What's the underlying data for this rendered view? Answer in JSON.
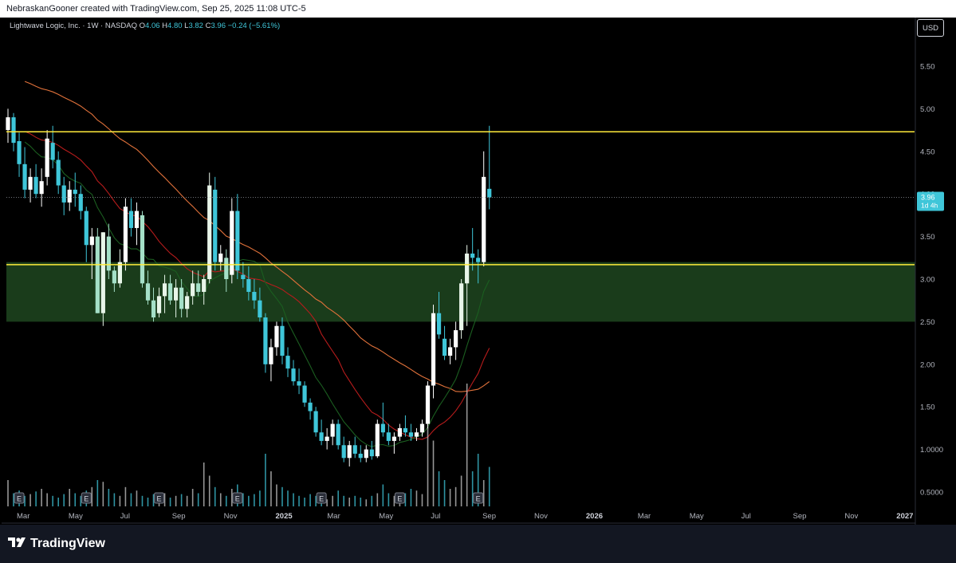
{
  "header": {
    "text": "NebraskanGooner created with TradingView.com, Sep 25, 2025 11:08 UTC-5"
  },
  "legend": {
    "symbol": "Lightwave Logic, Inc. · 1W · NASDAQ",
    "o_label": "O",
    "o": "4.06",
    "h_label": "H",
    "h": "4.80",
    "l_label": "L",
    "l": "3.82",
    "c_label": "C",
    "c": "3.96",
    "change": "−0.24 (−5.61%)"
  },
  "currency_button": "USD",
  "price_tag": {
    "price": "3.96",
    "countdown": "1d 4h"
  },
  "branding": {
    "logo_text": "TradingView"
  },
  "colors": {
    "up": "#ffffff",
    "down": "#3fc6d9",
    "ma_long": "#e0713a",
    "ma_mid": "#b71c1c",
    "ma_short": "#1b5e20",
    "resistance": "#ffeb3b",
    "zone_fill": "#1e4620",
    "axis_text": "#b2b5be",
    "bg": "#000000"
  },
  "chart_data": {
    "type": "candlestick",
    "timeframe": "1W",
    "y_ticks": [
      "5.50",
      "5.00",
      "4.50",
      "4.00",
      "3.50",
      "3.00",
      "2.50",
      "2.00",
      "1.50",
      "1.0000",
      "0.5000"
    ],
    "x_ticks": [
      "Mar",
      "May",
      "Jul",
      "Sep",
      "Nov",
      "2025",
      "Mar",
      "May",
      "Jul",
      "Sep",
      "Nov",
      "2026",
      "Mar",
      "May",
      "Jul",
      "Sep",
      "Nov",
      "2027"
    ],
    "bold_x_ticks": [
      "2025",
      "2026",
      "2027"
    ],
    "ylim": [
      0.35,
      5.8
    ],
    "last_close": 3.96,
    "levels": {
      "resistance": 4.73,
      "support": 3.17,
      "zone": [
        2.5,
        3.2
      ]
    },
    "candles": [
      [
        4.75,
        5.0,
        4.6,
        4.9
      ],
      [
        4.9,
        4.95,
        4.5,
        4.6
      ],
      [
        4.62,
        4.72,
        4.2,
        4.35
      ],
      [
        4.35,
        4.55,
        3.95,
        4.05
      ],
      [
        4.05,
        4.3,
        3.9,
        4.2
      ],
      [
        4.2,
        4.35,
        3.95,
        4.0
      ],
      [
        4.0,
        4.3,
        3.85,
        4.15
      ],
      [
        4.2,
        4.75,
        4.1,
        4.65
      ],
      [
        4.6,
        4.8,
        4.3,
        4.4
      ],
      [
        4.4,
        4.5,
        4.0,
        4.1
      ],
      [
        4.1,
        4.2,
        3.75,
        3.9
      ],
      [
        3.9,
        4.15,
        3.8,
        4.05
      ],
      [
        4.05,
        4.25,
        3.85,
        4.0
      ],
      [
        4.0,
        4.1,
        3.7,
        3.8
      ],
      [
        3.8,
        3.85,
        3.2,
        3.4
      ],
      [
        3.4,
        3.6,
        3.0,
        3.5
      ],
      [
        3.5,
        3.6,
        2.6,
        2.6
      ],
      [
        2.6,
        3.55,
        2.45,
        3.55
      ],
      [
        3.5,
        3.65,
        3.0,
        3.1
      ],
      [
        3.1,
        3.15,
        2.85,
        2.95
      ],
      [
        2.95,
        3.35,
        2.9,
        3.2
      ],
      [
        3.2,
        3.95,
        3.1,
        3.85
      ],
      [
        3.8,
        3.95,
        3.5,
        3.6
      ],
      [
        3.6,
        3.9,
        3.4,
        3.8
      ],
      [
        3.75,
        3.8,
        2.9,
        2.95
      ],
      [
        2.95,
        3.1,
        2.7,
        2.75
      ],
      [
        2.75,
        2.9,
        2.5,
        2.55
      ],
      [
        2.6,
        2.9,
        2.55,
        2.8
      ],
      [
        2.8,
        3.05,
        2.6,
        2.95
      ],
      [
        2.95,
        3.05,
        2.7,
        2.75
      ],
      [
        2.75,
        3.0,
        2.55,
        2.9
      ],
      [
        2.9,
        3.0,
        2.55,
        2.65
      ],
      [
        2.65,
        2.85,
        2.55,
        2.8
      ],
      [
        2.8,
        3.1,
        2.7,
        2.95
      ],
      [
        2.95,
        3.1,
        2.8,
        2.85
      ],
      [
        2.85,
        3.05,
        2.7,
        3.0
      ],
      [
        3.0,
        4.25,
        2.95,
        4.1
      ],
      [
        4.05,
        4.2,
        3.1,
        3.2
      ],
      [
        3.2,
        3.4,
        3.1,
        3.3
      ],
      [
        3.25,
        3.35,
        2.85,
        3.0
      ],
      [
        3.05,
        3.95,
        2.95,
        3.8
      ],
      [
        3.8,
        4.0,
        3.0,
        3.1
      ],
      [
        3.05,
        3.2,
        2.9,
        3.0
      ],
      [
        3.0,
        3.15,
        2.75,
        2.85
      ],
      [
        2.85,
        3.0,
        2.65,
        2.75
      ],
      [
        2.75,
        2.9,
        2.5,
        2.55
      ],
      [
        2.55,
        2.6,
        1.9,
        2.0
      ],
      [
        2.0,
        2.3,
        1.8,
        2.2
      ],
      [
        2.2,
        2.5,
        2.1,
        2.45
      ],
      [
        2.45,
        2.55,
        2.0,
        2.1
      ],
      [
        2.1,
        2.2,
        1.85,
        1.95
      ],
      [
        1.95,
        2.05,
        1.75,
        1.8
      ],
      [
        1.8,
        1.95,
        1.65,
        1.75
      ],
      [
        1.75,
        1.8,
        1.5,
        1.55
      ],
      [
        1.55,
        1.6,
        1.35,
        1.45
      ],
      [
        1.45,
        1.5,
        1.15,
        1.2
      ],
      [
        1.2,
        1.35,
        1.05,
        1.1
      ],
      [
        1.1,
        1.25,
        1.0,
        1.15
      ],
      [
        1.15,
        1.35,
        1.05,
        1.3
      ],
      [
        1.3,
        1.35,
        1.0,
        1.05
      ],
      [
        1.05,
        1.15,
        0.85,
        0.9
      ],
      [
        0.9,
        1.1,
        0.8,
        1.05
      ],
      [
        1.05,
        1.15,
        0.9,
        0.95
      ],
      [
        0.95,
        1.05,
        0.85,
        0.9
      ],
      [
        0.9,
        1.05,
        0.85,
        1.0
      ],
      [
        1.0,
        1.1,
        0.88,
        0.92
      ],
      [
        0.92,
        1.35,
        0.9,
        1.3
      ],
      [
        1.3,
        1.55,
        1.15,
        1.2
      ],
      [
        1.2,
        1.3,
        1.05,
        1.1
      ],
      [
        1.1,
        1.2,
        0.95,
        1.15
      ],
      [
        1.15,
        1.3,
        1.1,
        1.25
      ],
      [
        1.25,
        1.4,
        1.15,
        1.2
      ],
      [
        1.2,
        1.3,
        1.1,
        1.15
      ],
      [
        1.15,
        1.25,
        1.1,
        1.2
      ],
      [
        1.2,
        1.35,
        1.15,
        1.3
      ],
      [
        1.3,
        1.8,
        1.25,
        1.75
      ],
      [
        1.75,
        2.7,
        1.6,
        2.6
      ],
      [
        2.6,
        2.85,
        2.3,
        2.35
      ],
      [
        2.3,
        2.45,
        2.05,
        2.1
      ],
      [
        2.1,
        2.3,
        2.0,
        2.2
      ],
      [
        2.2,
        2.5,
        2.05,
        2.4
      ],
      [
        2.4,
        3.0,
        2.3,
        2.95
      ],
      [
        2.95,
        3.4,
        2.45,
        3.3
      ],
      [
        3.3,
        3.6,
        3.1,
        3.25
      ],
      [
        3.25,
        3.35,
        2.95,
        3.2
      ],
      [
        3.2,
        4.5,
        3.15,
        4.2
      ],
      [
        4.06,
        4.8,
        3.82,
        3.96
      ]
    ],
    "volume": [
      0.3,
      0.15,
      0.18,
      0.12,
      0.14,
      0.17,
      0.2,
      0.15,
      0.12,
      0.1,
      0.14,
      0.2,
      0.15,
      0.12,
      0.18,
      0.22,
      0.3,
      0.28,
      0.2,
      0.15,
      0.12,
      0.22,
      0.15,
      0.18,
      0.12,
      0.1,
      0.14,
      0.12,
      0.15,
      0.1,
      0.12,
      0.14,
      0.12,
      0.2,
      0.15,
      0.5,
      0.35,
      0.22,
      0.15,
      0.12,
      0.2,
      0.25,
      0.15,
      0.12,
      0.14,
      0.18,
      0.6,
      0.4,
      0.25,
      0.22,
      0.18,
      0.15,
      0.12,
      0.1,
      0.14,
      0.12,
      0.1,
      0.08,
      0.12,
      0.18,
      0.12,
      0.1,
      0.12,
      0.1,
      0.08,
      0.12,
      0.15,
      0.25,
      0.15,
      0.12,
      0.1,
      0.15,
      0.2,
      0.18,
      0.14,
      0.9,
      0.75,
      0.4,
      0.3,
      0.2,
      0.22,
      0.35,
      1.4,
      0.4,
      0.6,
      0.3,
      0.45
    ],
    "earnings_markers": [
      2,
      14,
      27,
      41,
      56,
      70,
      84
    ]
  }
}
